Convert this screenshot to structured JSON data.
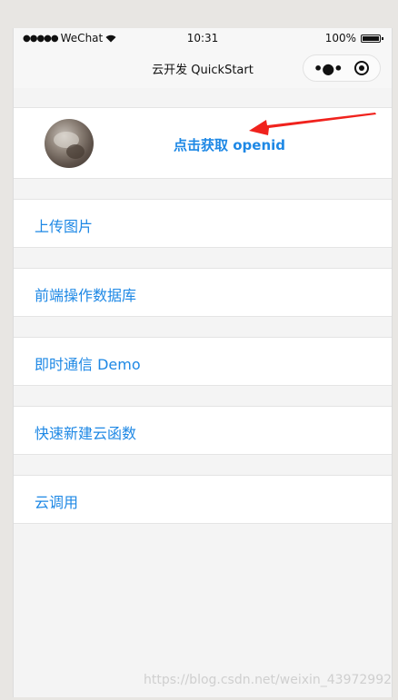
{
  "status_bar": {
    "carrier": "WeChat",
    "time": "10:31",
    "battery": "100%"
  },
  "nav": {
    "title": "云开发 QuickStart"
  },
  "user": {
    "openid_button_label": "点击获取 openid"
  },
  "menu": [
    {
      "label": "上传图片"
    },
    {
      "label": "前端操作数据库"
    },
    {
      "label": "即时通信 Demo"
    },
    {
      "label": "快速新建云函数"
    },
    {
      "label": "云调用"
    }
  ],
  "annotation": {
    "arrow_color": "#f0221d"
  },
  "watermark": "https://blog.csdn.net/weixin_43972992",
  "colors": {
    "link": "#1e88e5",
    "page_bg": "#f4f4f4"
  }
}
